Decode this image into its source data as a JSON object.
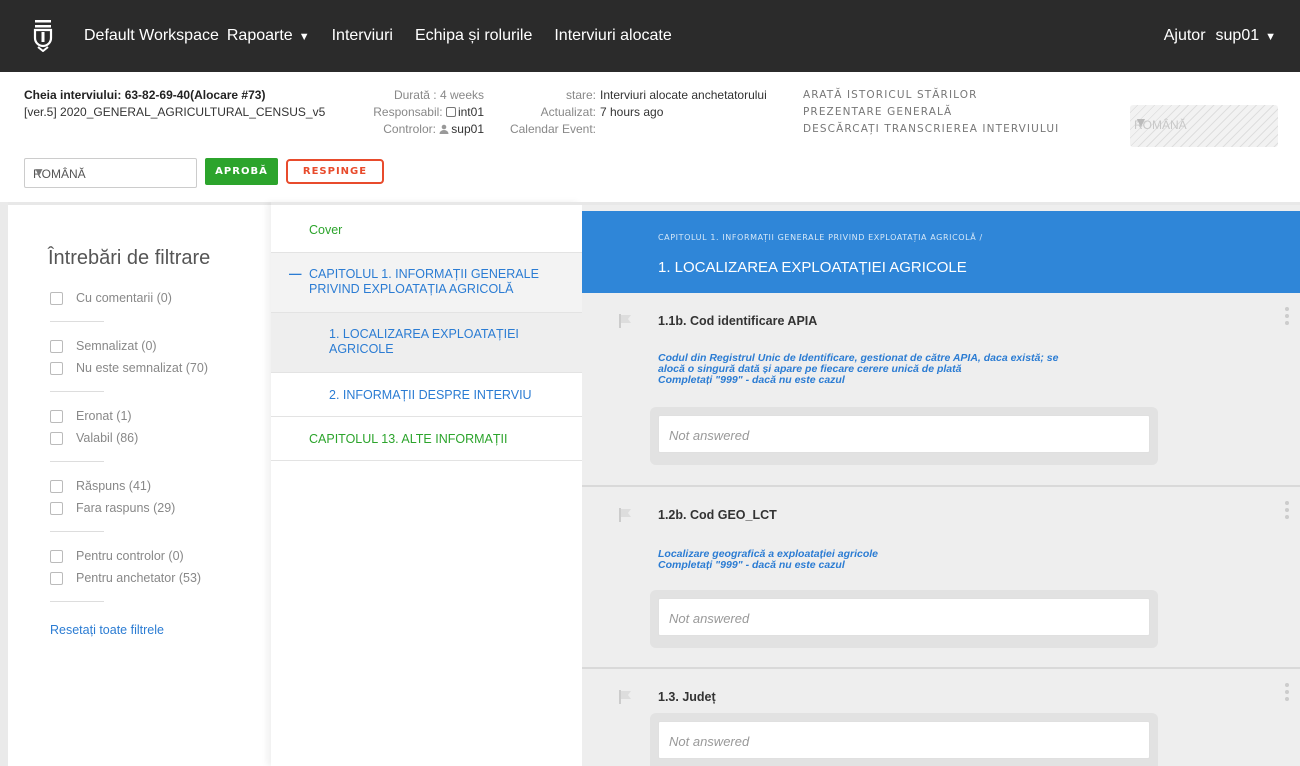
{
  "nav": {
    "workspace": "Default Workspace",
    "reports": "Rapoarte",
    "interviews": "Interviuri",
    "team": "Echipa și rolurile",
    "assigned": "Interviuri alocate",
    "help": "Ajutor",
    "user": "sup01"
  },
  "interview": {
    "key_label": "Cheia interviului:",
    "key_value": "63-82-69-40(Alocare #73)",
    "questionnaire": "[ver.5] 2020_GENERAL_AGRICULTURAL_CENSUS_v5",
    "duration_label": "Durată :",
    "duration_value": "4 weeks",
    "responsible_label": "Responsabil:",
    "responsible_value": "int01",
    "controller_label": "Controlor:",
    "controller_value": "sup01",
    "status_label": "stare:",
    "status_value": "Interviuri alocate anchetatorului",
    "updated_label": "Actualizat:",
    "updated_value": "7 hours ago",
    "calendar_label": "Calendar Event:",
    "link_history": "ARATĂ ISTORICUL STĂRILOR",
    "link_overview": "PREZENTARE GENERALĂ",
    "link_download": "DESCĂRCAȚI TRANSCRIEREA INTERVIULUI",
    "lang_disabled": "ROMÂNĂ",
    "lang_select": "ROMÂNĂ",
    "approve": "APROBĂ",
    "reject": "RESPINGE"
  },
  "filters": {
    "title": "Întrebări de filtrare",
    "with_comments": "Cu comentarii (0)",
    "flagged": "Semnalizat (0)",
    "not_flagged": "Nu este semnalizat (70)",
    "invalid": "Eronat (1)",
    "valid": "Valabil (86)",
    "answered": "Răspuns (41)",
    "not_answered": "Fara raspuns (29)",
    "for_supervisor": "Pentru controlor (0)",
    "for_interviewer": "Pentru anchetator (53)",
    "reset": "Resetați toate filtrele"
  },
  "sections": {
    "cover": "Cover",
    "chapter1": "CAPITOLUL 1. INFORMAȚII GENERALE PRIVIND EXPLOATAȚIA AGRICOLĂ",
    "sub1": "1. LOCALIZAREA EXPLOATAȚIEI AGRICOLE",
    "sub2": "2. INFORMAȚII DESPRE INTERVIU",
    "chapter13": "CAPITOLUL 13. ALTE INFORMAȚII"
  },
  "main": {
    "breadcrumb": "CAPITOLUL 1. INFORMAȚII GENERALE PRIVIND EXPLOATAȚIA AGRICOLĂ  /",
    "title": "1. LOCALIZAREA EXPLOATAȚIEI AGRICOLE",
    "questions": [
      {
        "title": "1.1b. Cod identificare APIA",
        "instruction": "Codul din Registrul Unic de Identificare, gestionat de către APIA, daca există; se\nalocă o singură dată și apare pe fiecare cerere unică de plată\nCompletați \"999\" -  dacă nu este cazul",
        "answer": "Not answered"
      },
      {
        "title": "1.2b. Cod GEO_LCT",
        "instruction": "Localizare geografică a exploatației agricole\nCompletați \"999\" -  dacă nu este cazul",
        "answer": "Not answered"
      },
      {
        "title": "1.3. Județ",
        "instruction": "",
        "answer": "Not answered"
      }
    ]
  }
}
